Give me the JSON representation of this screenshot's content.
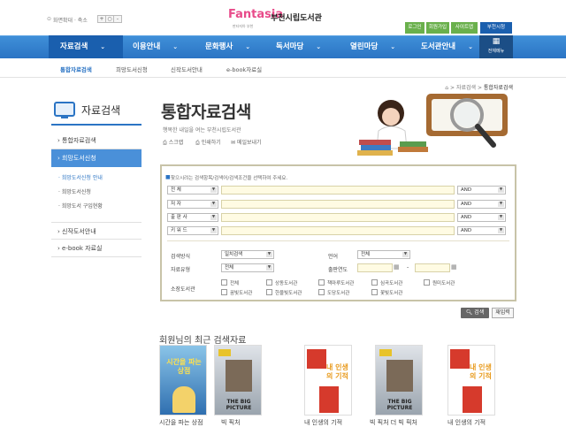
{
  "header": {
    "zoom_label": "화면확대 · 축소",
    "zoom_plus": "+",
    "zoom_reset": "○",
    "zoom_minus": "-",
    "logo_word": "Fantasia",
    "logo_sub": "판타지아 부천",
    "logo_title": "부천시립도서관",
    "util_links": [
      "로그인",
      "회원가입",
      "사이트맵",
      "부천시청"
    ]
  },
  "nav": {
    "items": [
      "자료검색",
      "이용안내",
      "문화행사",
      "독서마당",
      "열린마당",
      "도서관안내"
    ],
    "all_menu_label": "전체메뉴"
  },
  "subnav": {
    "items": [
      "통합자료검색",
      "희망도서신청",
      "신작도서안내",
      "e-book자료실"
    ]
  },
  "breadcrumb": {
    "items": [
      "자료검색",
      "통합자료검색"
    ]
  },
  "sidebar": {
    "title": "자료검색",
    "items": [
      {
        "label": "통합자료검색"
      },
      {
        "label": "희망도서신청"
      },
      {
        "label": "신작도서안내"
      },
      {
        "label": "e-book 자료실"
      }
    ],
    "sub_items": [
      "희망도서신청 안내",
      "희망도서신청",
      "희망도서 구입현황"
    ]
  },
  "page": {
    "title": "통합자료검색",
    "subtitle": "행복한 내일을 여는 부천시립도서관",
    "tools": [
      "스크랩",
      "인쇄하기",
      "메일보내기"
    ]
  },
  "search": {
    "hint": "찾으시려는 검색항목/검색어/검색조건을 선택하여 주세요.",
    "rows": [
      {
        "field": "전 체",
        "op": "AND"
      },
      {
        "field": "저 자",
        "op": "AND"
      },
      {
        "field": "출 판 사",
        "op": "AND"
      },
      {
        "field": "키 워 드",
        "op": "AND"
      }
    ],
    "method_label": "검색방식",
    "method_value": "일치검색",
    "lang_label": "언어",
    "lang_value": "전체",
    "type_label": "자료유형",
    "type_value": "전체",
    "year_label": "출판연도",
    "year_sep": "-",
    "lib_label": "소장도서관",
    "libraries": [
      "전체",
      "상동도서관",
      "책마루도서관",
      "심곡도서관",
      "원미도서관",
      "꿈빛도서관",
      "한울빛도서관",
      "도당도서관",
      "꽃빛도서관"
    ],
    "search_btn": "검색",
    "reset_btn": "재입력"
  },
  "recent": {
    "title": "회원님의 최근 검색자료",
    "books": [
      {
        "cover_title": "시간을 파는 상점",
        "caption": "시간을 파는 상점"
      },
      {
        "cover_title": "THE BIG PICTURE",
        "caption": "빅 픽처"
      },
      {
        "cover_title": "내 인생의 기적",
        "caption": "내 인생의 기적"
      },
      {
        "cover_title": "THE BIG PICTURE",
        "caption": "빅 픽처 더 빅 픽처"
      },
      {
        "cover_title": "내 인생의 기적",
        "caption": "내 인생의 기적"
      }
    ]
  },
  "colors": {
    "nav_blue": "#2b74c4",
    "nav_active": "#1a5fae",
    "green": "#6ab04c"
  }
}
